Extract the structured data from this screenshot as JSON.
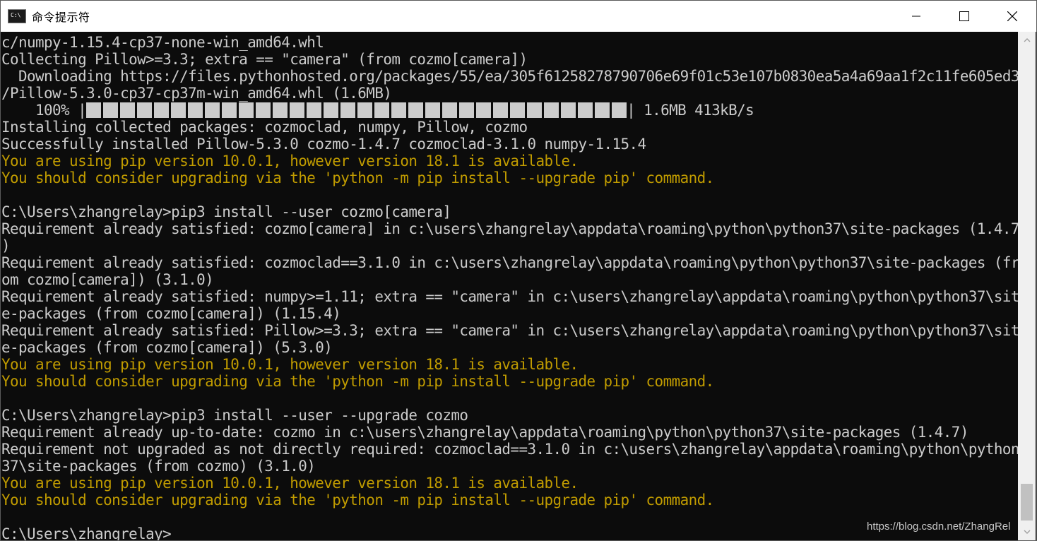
{
  "window": {
    "title": "命令提示符",
    "icon_label": "C:\\"
  },
  "controls": {
    "minimize": "minimize-icon",
    "maximize": "maximize-icon",
    "close": "close-icon"
  },
  "progress": {
    "percent": 100,
    "fraction": 1.0
  },
  "console": {
    "lines": [
      {
        "text": "c/numpy-1.15.4-cp37-none-win_amd64.whl",
        "kind": "normal"
      },
      {
        "text": "Collecting Pillow>=3.3; extra == \"camera\" (from cozmo[camera])",
        "kind": "normal"
      },
      {
        "text": "  Downloading https://files.pythonhosted.org/packages/55/ea/305f61258278790706e69f01c53e107b0830ea5a4a69aa1f2c11fe605ed3",
        "kind": "normal"
      },
      {
        "text": "/Pillow-5.3.0-cp37-cp37m-win_amd64.whl (1.6MB)",
        "kind": "normal"
      },
      {
        "prefix": "    100% |",
        "suffix": "| 1.6MB 413kB/s",
        "kind": "progress"
      },
      {
        "text": "Installing collected packages: cozmoclad, numpy, Pillow, cozmo",
        "kind": "normal"
      },
      {
        "text": "Successfully installed Pillow-5.3.0 cozmo-1.4.7 cozmoclad-3.1.0 numpy-1.15.4",
        "kind": "normal"
      },
      {
        "text": "You are using pip version 10.0.1, however version 18.1 is available.",
        "kind": "warn"
      },
      {
        "text": "You should consider upgrading via the 'python -m pip install --upgrade pip' command.",
        "kind": "warn"
      },
      {
        "text": "",
        "kind": "normal"
      },
      {
        "text": "C:\\Users\\zhangrelay>pip3 install --user cozmo[camera]",
        "kind": "normal"
      },
      {
        "text": "Requirement already satisfied: cozmo[camera] in c:\\users\\zhangrelay\\appdata\\roaming\\python\\python37\\site-packages (1.4.7",
        "kind": "normal"
      },
      {
        "text": ")",
        "kind": "normal"
      },
      {
        "text": "Requirement already satisfied: cozmoclad==3.1.0 in c:\\users\\zhangrelay\\appdata\\roaming\\python\\python37\\site-packages (fr",
        "kind": "normal"
      },
      {
        "text": "om cozmo[camera]) (3.1.0)",
        "kind": "normal"
      },
      {
        "text": "Requirement already satisfied: numpy>=1.11; extra == \"camera\" in c:\\users\\zhangrelay\\appdata\\roaming\\python\\python37\\sit",
        "kind": "normal"
      },
      {
        "text": "e-packages (from cozmo[camera]) (1.15.4)",
        "kind": "normal"
      },
      {
        "text": "Requirement already satisfied: Pillow>=3.3; extra == \"camera\" in c:\\users\\zhangrelay\\appdata\\roaming\\python\\python37\\sit",
        "kind": "normal"
      },
      {
        "text": "e-packages (from cozmo[camera]) (5.3.0)",
        "kind": "normal"
      },
      {
        "text": "You are using pip version 10.0.1, however version 18.1 is available.",
        "kind": "warn"
      },
      {
        "text": "You should consider upgrading via the 'python -m pip install --upgrade pip' command.",
        "kind": "warn"
      },
      {
        "text": "",
        "kind": "normal"
      },
      {
        "text": "C:\\Users\\zhangrelay>pip3 install --user --upgrade cozmo",
        "kind": "normal"
      },
      {
        "text": "Requirement already up-to-date: cozmo in c:\\users\\zhangrelay\\appdata\\roaming\\python\\python37\\site-packages (1.4.7)",
        "kind": "normal"
      },
      {
        "text": "Requirement not upgraded as not directly required: cozmoclad==3.1.0 in c:\\users\\zhangrelay\\appdata\\roaming\\python\\python",
        "kind": "normal"
      },
      {
        "text": "37\\site-packages (from cozmo) (3.1.0)",
        "kind": "normal"
      },
      {
        "text": "You are using pip version 10.0.1, however version 18.1 is available.",
        "kind": "warn"
      },
      {
        "text": "You should consider upgrading via the 'python -m pip install --upgrade pip' command.",
        "kind": "warn"
      },
      {
        "text": "",
        "kind": "normal"
      },
      {
        "text": "C:\\Users\\zhangrelay>",
        "kind": "normal"
      }
    ]
  },
  "watermark": "https://blog.csdn.net/ZhangRel",
  "colors": {
    "background": "#0c0c0c",
    "text": "#cccccc",
    "warning": "#c19c00",
    "titlebar": "#ffffff"
  }
}
